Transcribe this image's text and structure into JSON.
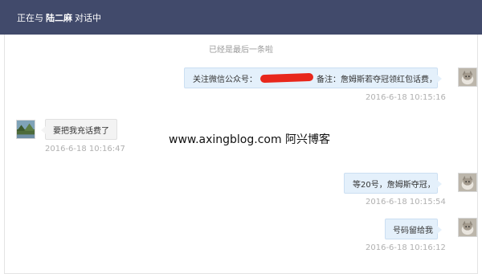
{
  "header": {
    "prefix": "正在与",
    "contact_name": "陆二麻",
    "suffix": "对话中"
  },
  "notice": "已经是最后一条啦",
  "messages": [
    {
      "side": "right",
      "text_before": "关注微信公众号：",
      "text_after": "备注：詹姆斯若夺冠领红包话费，",
      "timestamp": "2016-6-18 10:15:16"
    },
    {
      "side": "left",
      "text": "要把我充话费了",
      "timestamp": "2016-6-18 10:16:47"
    },
    {
      "side": "right",
      "text": "等20号，詹姆斯夺冠，",
      "timestamp": "2016-6-18 10:15:54"
    },
    {
      "side": "right",
      "text": "号码留给我",
      "timestamp": "2016-6-18 10:16:12"
    }
  ],
  "watermark": "www.axingblog.com 阿兴博客",
  "icons": {
    "self_avatar": "cat-avatar-icon",
    "contact_avatar": "landscape-avatar-icon",
    "redaction": "redaction-mark"
  },
  "colors": {
    "header_bg": "#414a6b",
    "bubble_self": "#e4f0fb",
    "bubble_other": "#f3f3f3",
    "redaction": "#e8271c"
  }
}
